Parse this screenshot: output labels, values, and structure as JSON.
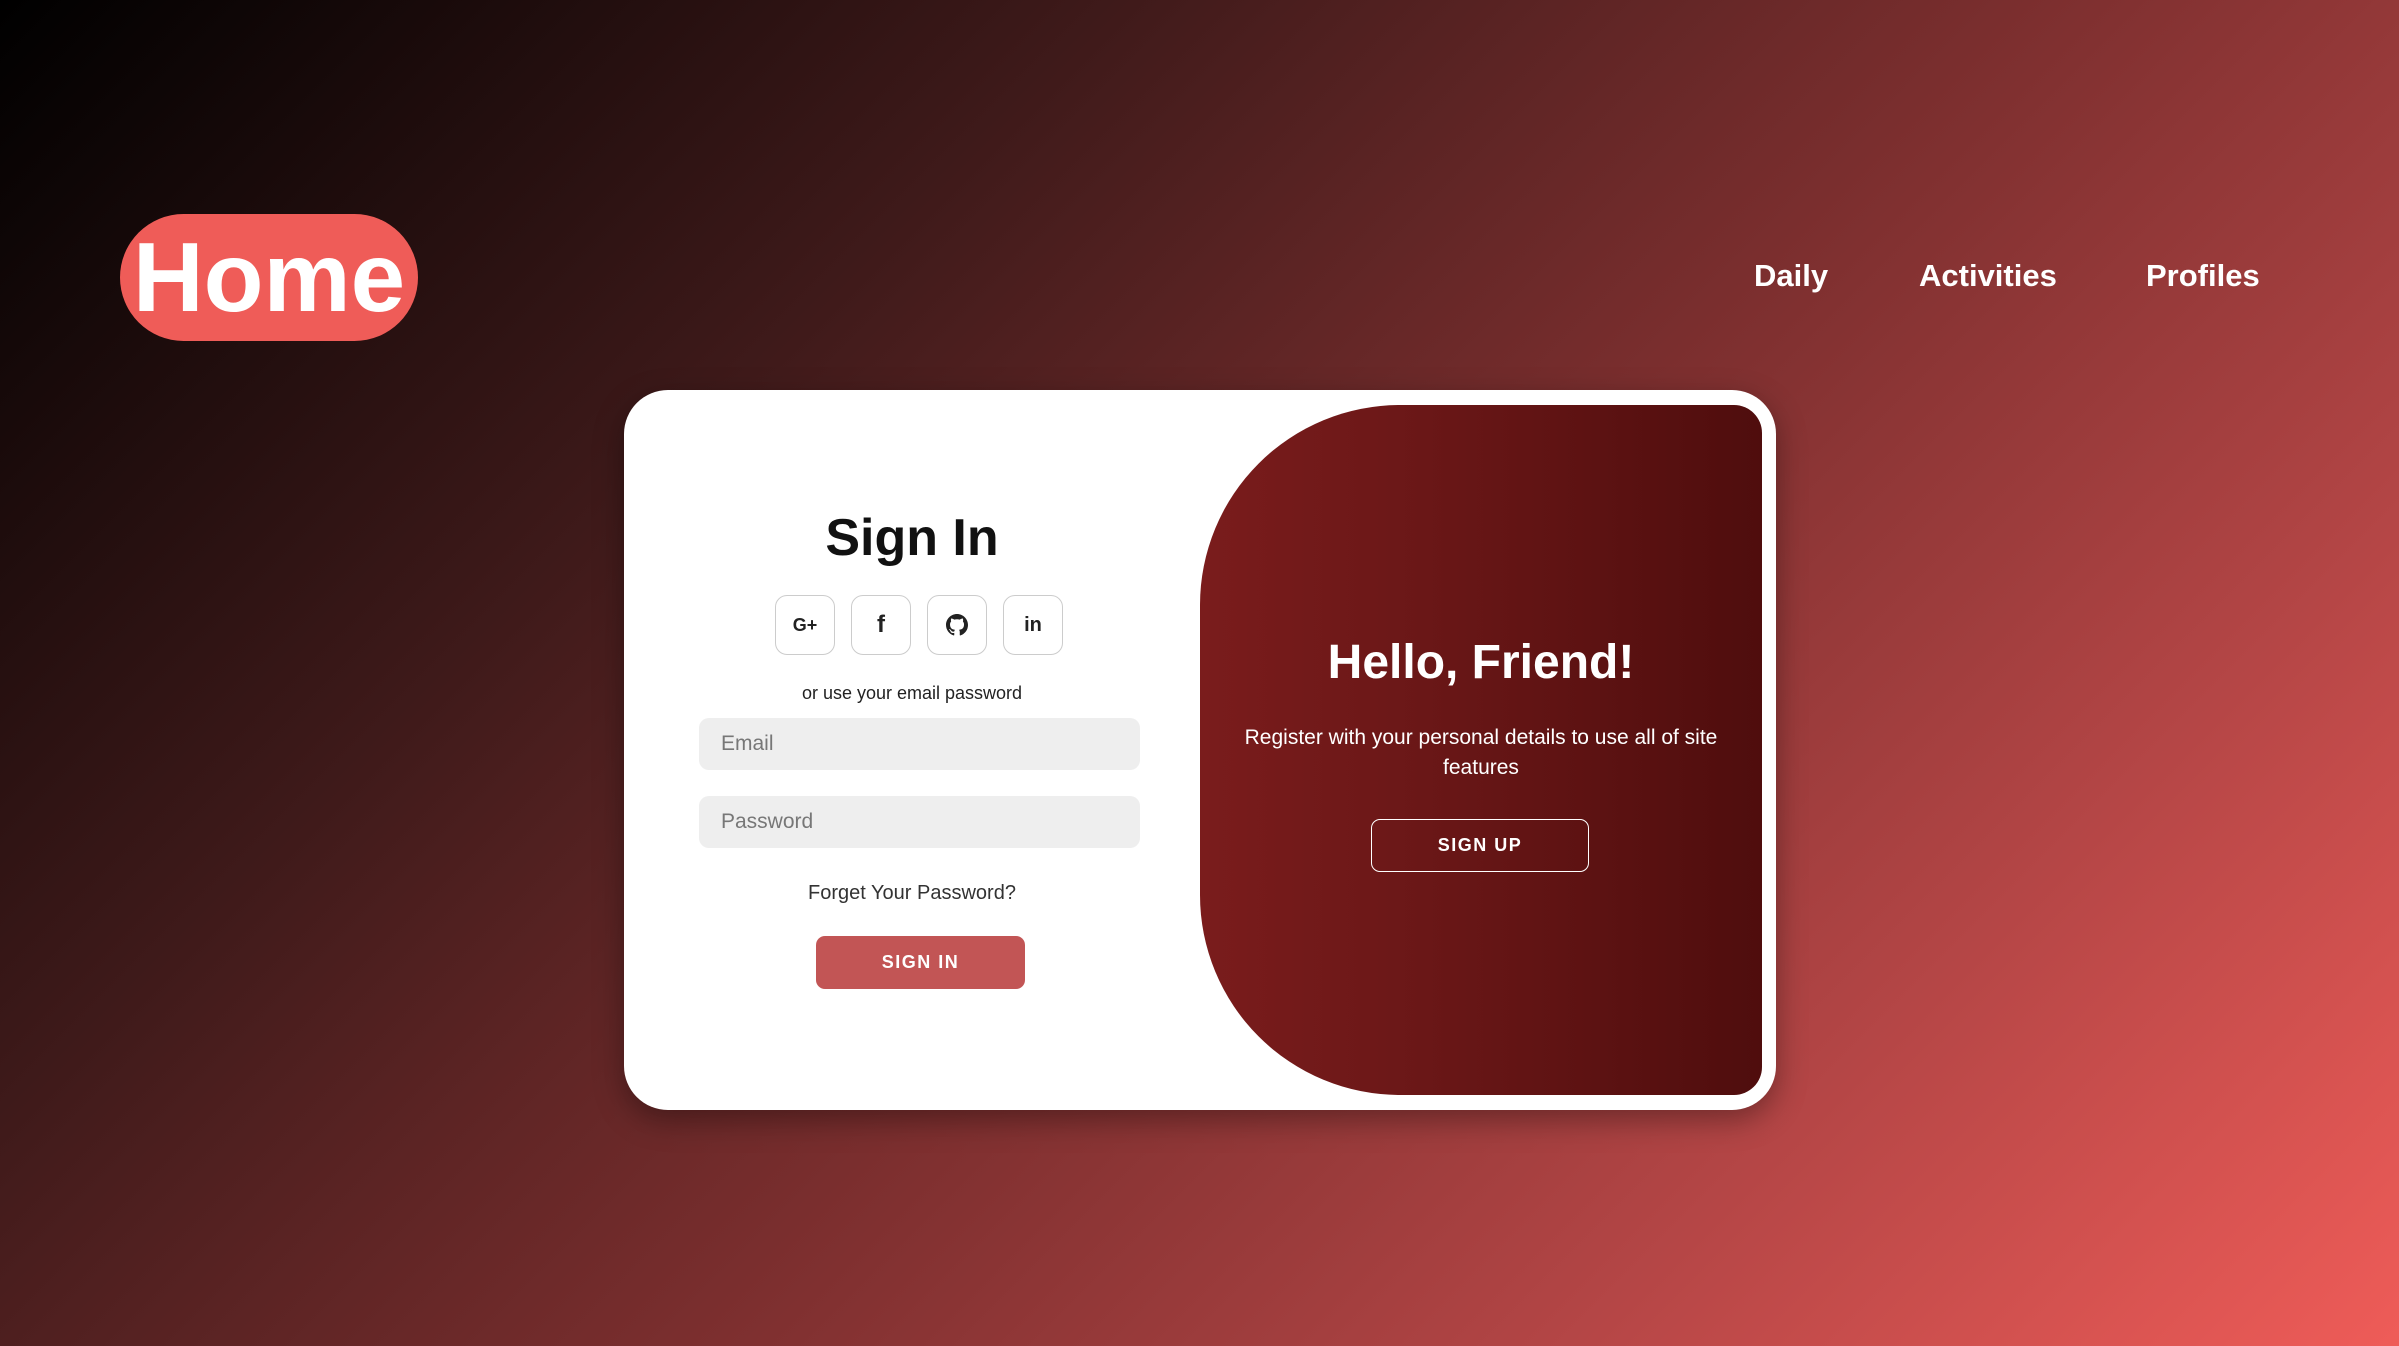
{
  "header": {
    "logo": "Home",
    "nav": [
      {
        "label": "Daily"
      },
      {
        "label": "Activities"
      },
      {
        "label": "Profiles"
      }
    ]
  },
  "signin": {
    "title": "Sign In",
    "social": [
      {
        "label": "G+",
        "icon": "google-plus-icon"
      },
      {
        "label": "f",
        "icon": "facebook-icon"
      },
      {
        "label": "",
        "icon": "github-icon"
      },
      {
        "label": "in",
        "icon": "linkedin-icon"
      }
    ],
    "or_text": "or use your email password",
    "email_placeholder": "Email",
    "password_placeholder": "Password",
    "forgot": "Forget Your Password?",
    "button": "SIGN IN"
  },
  "toggle": {
    "title": "Hello, Friend!",
    "text": "Register with your personal details to use all of site features",
    "button": "SIGN UP"
  },
  "colors": {
    "accent": "#ef5c58",
    "signin_button": "#c25555",
    "panel_dark": "#5a1010"
  }
}
